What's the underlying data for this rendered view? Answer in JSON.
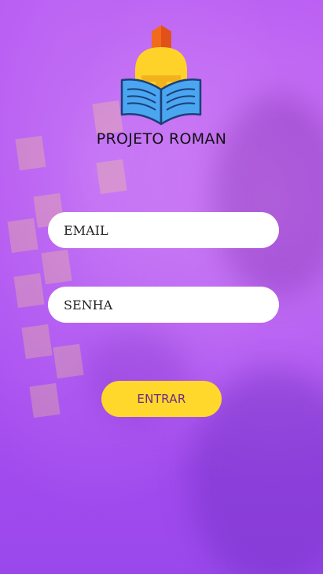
{
  "brand": {
    "title": "PROJETO ROMAN",
    "logo_icon": "spartan-helmet-book-icon"
  },
  "form": {
    "email_placeholder": "EMAIL",
    "password_placeholder": "SENHA",
    "submit_label": "ENTRAR"
  },
  "colors": {
    "overlay_purple": "#b150ef",
    "button_yellow": "#ffd82b",
    "button_text": "#6b2a8a",
    "book_blue": "#4aa6f0",
    "helmet_yellow": "#ffd22a",
    "crest_orange": "#f26a1b"
  }
}
